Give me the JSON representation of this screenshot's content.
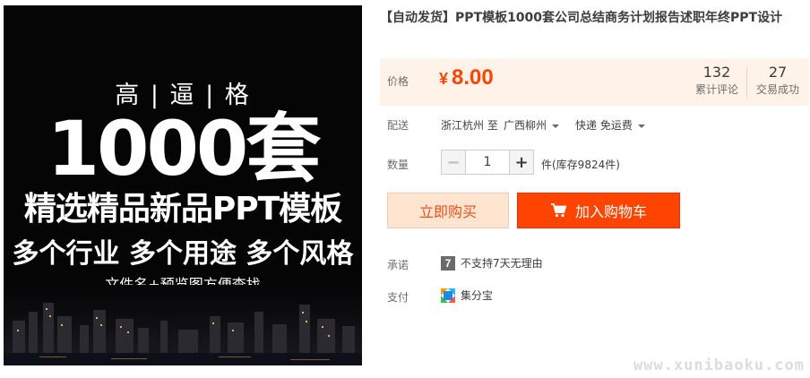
{
  "product_image": {
    "line1": "高 | 逼 | 格",
    "line2": "1000套",
    "line3": "精选精品新品PPT模板",
    "line4": "多个行业 多个用途 多个风格",
    "line5": "文件名+预览图方便查找"
  },
  "title": "【自动发货】PPT模板1000套公司总结商务计划报告述职年终PPT设计",
  "price": {
    "label": "价格",
    "currency": "¥",
    "value": "8.00",
    "reviews_count": "132",
    "reviews_label": "累计评论",
    "trades_count": "27",
    "trades_label": "交易成功"
  },
  "shipping": {
    "label": "配送",
    "from": "浙江杭州 至",
    "to": "广西柳州",
    "method": "快递 免运费"
  },
  "quantity": {
    "label": "数量",
    "minus": "−",
    "value": "1",
    "plus": "+",
    "stock": "件(库存9824件)"
  },
  "actions": {
    "buy_now": "立即购买",
    "add_to_cart": "加入购物车"
  },
  "promise": {
    "label": "承诺",
    "icon_text": "7",
    "text": "不支持7天无理由"
  },
  "payment": {
    "label": "支付",
    "text": "集分宝"
  },
  "watermark": "www.xunibaoku.com",
  "colors": {
    "accent": "#ff4400",
    "price_bg": "#fff2e8",
    "buy_now_bg": "#ffe4d0"
  },
  "icons": {
    "cart": "cart-icon",
    "seven_day": "seven-day-icon",
    "payment": "jifenbao-icon",
    "dropdown": "chevron-down-icon"
  }
}
